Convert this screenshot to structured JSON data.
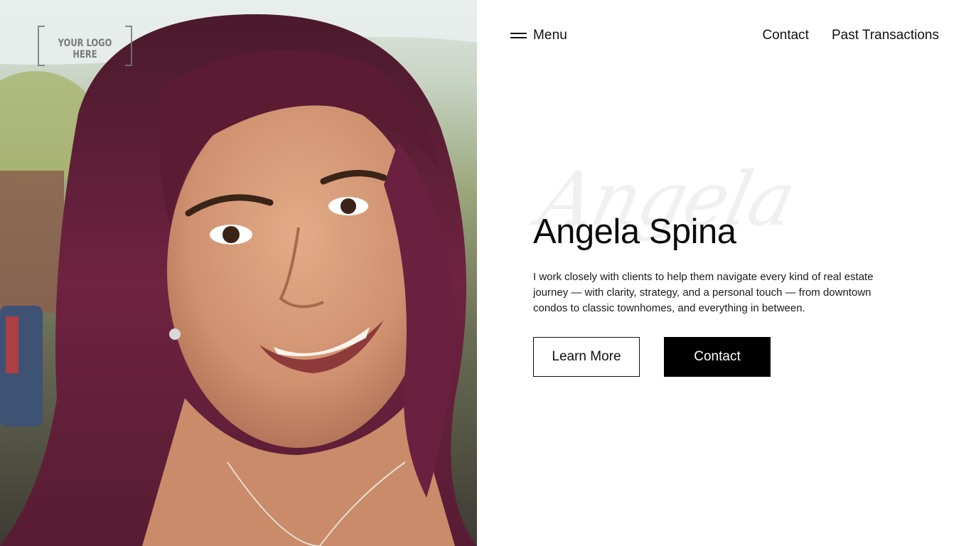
{
  "logo": {
    "text": "YOUR LOGO HERE"
  },
  "nav": {
    "menu_label": "Menu",
    "links": [
      {
        "label": "Contact"
      },
      {
        "label": "Past Transactions"
      }
    ]
  },
  "hero": {
    "script_name": "Angela",
    "title": "Angela Spina",
    "description": "I work closely with clients to help them navigate every kind of real estate journey — with clarity, strategy, and a personal touch — from downtown condos to classic townhomes, and everything in between.",
    "buttons": {
      "learn_more": "Learn More",
      "contact": "Contact"
    }
  },
  "colors": {
    "hair": "#6a1e3a",
    "skin": "#d39a78",
    "background": "#ffffff",
    "button_solid": "#000000"
  }
}
